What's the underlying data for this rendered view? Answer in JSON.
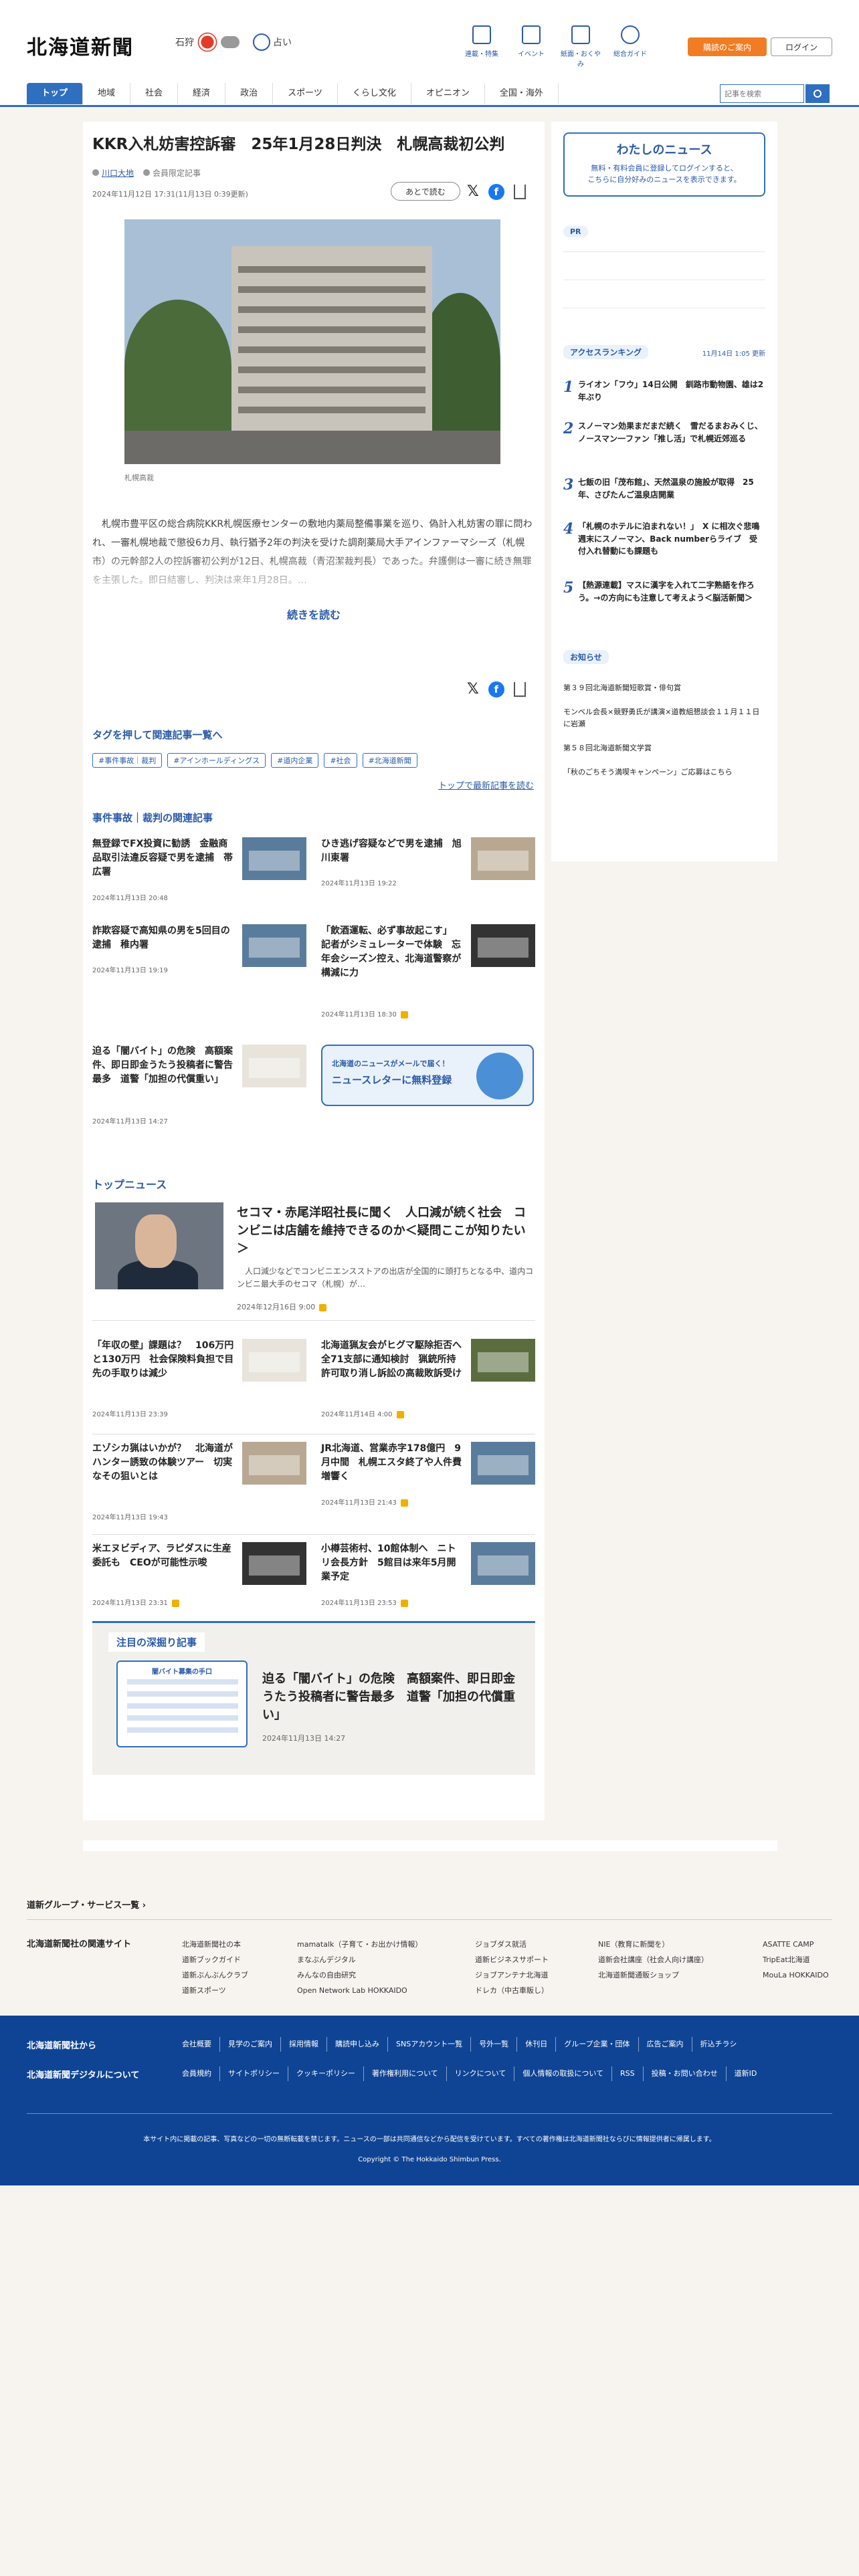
{
  "header": {
    "logo": "北海道新聞",
    "weather": {
      "city": "石狩"
    },
    "fortune": "占い",
    "nav_icons": [
      {
        "label": "連載・特集",
        "icon": "flag-icon"
      },
      {
        "label": "イベント",
        "icon": "calendar-icon"
      },
      {
        "label": "紙面・おくやみ",
        "icon": "newspaper-icon"
      },
      {
        "label": "総合ガイド",
        "icon": "help-icon"
      }
    ],
    "guide_button": "購読のご案内",
    "login_button": "ログイン"
  },
  "nav": {
    "tabs": [
      "トップ",
      "地域",
      "社会",
      "経済",
      "政治",
      "スポーツ",
      "くらし文化",
      "オピニオン",
      "全国・海外"
    ],
    "search_placeholder": "記事を検索"
  },
  "article": {
    "title": "KKR入札妨害控訴審　25年1月28日判決　札幌高裁初公判",
    "author": "川口大地",
    "member_label": "会員限定記事",
    "date": "2024年11月12日 17:31(11月13日 0:39更新)",
    "save_label": "あとで読む",
    "photo_caption": "札幌高裁",
    "body": "札幌市豊平区の総合病院KKR札幌医療センターの敷地内薬局整備事業を巡り、偽計入札妨害の罪に問われ、一審札幌地裁で懲役6カ月、執行猶予2年の判決を受けた調剤薬局大手アインファーマシーズ（札幌市）の元幹部2人の控訴審初公判が12日、札幌高裁（青沼潔裁判長）であった。弁護側は一審に続き無罪を主張した。即日結審し、判決は来年1月28日。…",
    "read_more": "続きを読む"
  },
  "tags": {
    "heading": "タグを押して関連記事一覧へ",
    "items": [
      "#事件事故｜裁判",
      "#アインホールディングス",
      "#道内企業",
      "#社会",
      "#北海道新聞"
    ],
    "top_more": "トップで最新記事を読む"
  },
  "related": {
    "heading": "事件事故｜裁判の関連記事",
    "items": [
      {
        "title": "無登録でFX投資に勧誘　金融商品取引法違反容疑で男を逮捕　帯広署",
        "date": "2024年11月13日 20:48",
        "locked": false
      },
      {
        "title": "ひき逃げ容疑などで男を逮捕　旭川東署",
        "date": "2024年11月13日 19:22",
        "locked": false
      },
      {
        "title": "詐欺容疑で高知県の男を5回目の逮捕　稚内署",
        "date": "2024年11月13日 19:19",
        "locked": false
      },
      {
        "title": "「飲酒運転、必ず事故起こす」　記者がシミュレーターで体験　忘年会シーズン控え、北海道警察が構減に力",
        "date": "2024年11月13日 18:30",
        "locked": true
      },
      {
        "title": "迫る「闇バイト」の危険　高額案件、即日即金うたう投稿者に警告最多　道警「加担の代償重い」",
        "date": "2024年11月13日 14:27",
        "locked": false
      }
    ],
    "newsletter_sub": "北海道のニュースがメールで届く！",
    "newsletter_cta": "ニュースレターに無料登録"
  },
  "top_news": {
    "heading": "トップニュース",
    "featured": {
      "title": "セコマ・赤尾洋昭社長に聞く　人口減が続く社会　コンビニは店舗を維持できるのか＜疑問ここが知りたい＞",
      "summary": "人口減少などでコンビニエンスストアの出店が全国的に頭打ちとなる中、道内コンビニ最大手のセコマ（札幌）が…",
      "date": "2024年12月16日 9:00"
    },
    "items": [
      {
        "title": "「年収の壁」課題は？　106万円と130万円　社会保険料負担で目先の手取りは減少",
        "date": "2024年11月13日 23:39",
        "locked": false
      },
      {
        "title": "北海道猟友会がヒグマ駆除拒否へ　全71支部に通知検討　猟銃所持許可取り消し訴訟の高裁敗訴受け",
        "date": "2024年11月14日 4:00",
        "locked": true
      },
      {
        "title": "エゾシカ猟はいかが？　北海道がハンター誘致の体験ツアー　切実なその狙いとは",
        "date": "2024年11月13日 19:43",
        "locked": false
      },
      {
        "title": "JR北海道、営業赤字178億円　9月中間　札幌エスタ終了や人件費増響く",
        "date": "2024年11月13日 21:43",
        "locked": true
      },
      {
        "title": "米エヌビディア、ラピダスに生産委託も　CEOが可能性示唆",
        "date": "2024年11月13日 23:31",
        "locked": true
      },
      {
        "title": "小樽芸術村、10館体制へ　ニトリ会長方針　5館目は来年5月開業予定",
        "date": "2024年11月13日 23:53",
        "locked": true
      }
    ]
  },
  "deep_dive": {
    "heading": "注目の深掘り記事",
    "image_heading": "闇バイト募集の手口",
    "image_lines": [
      "交流サイト(SNS)で「高額案件」や「即日即金」と勧誘",
      "秘匿性の高い通信アプリでのやりとりに誘導",
      "運転免許証や顔写真など個人情報の提供を要求",
      "特殊詐欺や強盗、窃盗の実行役を指示",
      "犯罪への加担を断ると、家族に危害を加えるなどと脅迫"
    ],
    "title": "迫る「闇バイト」の危険　高額案件、即日即金うたう投稿者に警告最多　道警「加担の代償重い」",
    "date": "2024年11月13日 14:27"
  },
  "sidebar": {
    "my_news_title": "わたしのニュース",
    "my_news_text_1": "無料・有料会員に登録してログインすると、",
    "my_news_text_2": "こちらに自分好みのニュースを表示できます。",
    "pr_label": "PR",
    "ranking_label": "アクセスランキング",
    "ranking_updated": "11月14日 1:05 更新",
    "ranking": [
      {
        "n": "1",
        "title": "ライオン「フウ」14日公開　釧路市動物園、雄は2年ぶり"
      },
      {
        "n": "2",
        "title": "スノーマン効果まだまだ続く　雪だるまおみくじ、ノースマン一ファン「推し活」で札幌近郊巡る"
      },
      {
        "n": "3",
        "title": "七飯の旧「茂布館」、天然温泉の施設が取得　25年、さぴたんご温泉店開業"
      },
      {
        "n": "4",
        "title": "「札幌のホテルに泊まれない！」　X に相次ぐ悲鳴　週末にスノーマン、Back numberらライブ　受付入れ替動にも課題も"
      },
      {
        "n": "5",
        "title": "【熱源連載】マスに漢字を入れて二字熟語を作ろう。→の方向にも注意して考えよう＜脳活新聞＞"
      }
    ],
    "notice_label": "お知らせ",
    "notices": [
      "第３９回北海道新聞短歌賞・俳句賞",
      "モンベル会長×競野勇氏が講演×道教組懇談会１１月１１日に岩瀬",
      "第５８回北海道新聞文学賞",
      "「秋のごちそう満喫キャンペーン」ご応募はこちら"
    ]
  },
  "footer": {
    "group_link": "道新グループ・サービス一覧",
    "related_title": "北海道新聞社の関連サイト",
    "related_cols": [
      [
        "北海道新聞社の本",
        "道新ブックガイド",
        "道新ぶんぶんクラブ",
        "道新スポーツ"
      ],
      [
        "mamatalk（子育て・お出かけ情報）",
        "まなぶんデジタル",
        "みんなの自由研究",
        "Open Network Lab HOKKAIDO"
      ],
      [
        "ジョブダス就活",
        "道新ビジネスサポート",
        "ジョブアンテナ北海道",
        "ドレカ（中古車販し）"
      ],
      [
        "NIE（教育に新聞を）",
        "道新会社講座（社会人向け講座）",
        "北海道新聞通販ショップ"
      ],
      [
        "ASATTE CAMP",
        "TripEat北海道",
        "MouLa HOKKAIDO"
      ]
    ],
    "company_title": "北海道新聞社から",
    "company_links": [
      "会社概要",
      "見学のご案内",
      "採用情報",
      "購読申し込み",
      "SNSアカウント一覧",
      "号外一覧",
      "休刊日",
      "グループ企業・団体",
      "広告ご案内",
      "折込チラシ"
    ],
    "digital_title": "北海道新聞デジタルについて",
    "digital_links": [
      "会員規約",
      "サイトポリシー",
      "クッキーポリシー",
      "著作権利用について",
      "リンクについて",
      "個人情報の取扱について",
      "RSS",
      "投稿・お問い合わせ",
      "道新ID"
    ],
    "note": "本サイト内に掲載の記事、写真などの一切の無断転載を禁じます。ニュースの一部は共同通信などから配信を受けています。すべての著作権は北海道新聞社ならびに情報提供者に帰属します。",
    "copyright": "Copyright © The Hokkaido Shimbun Press."
  }
}
